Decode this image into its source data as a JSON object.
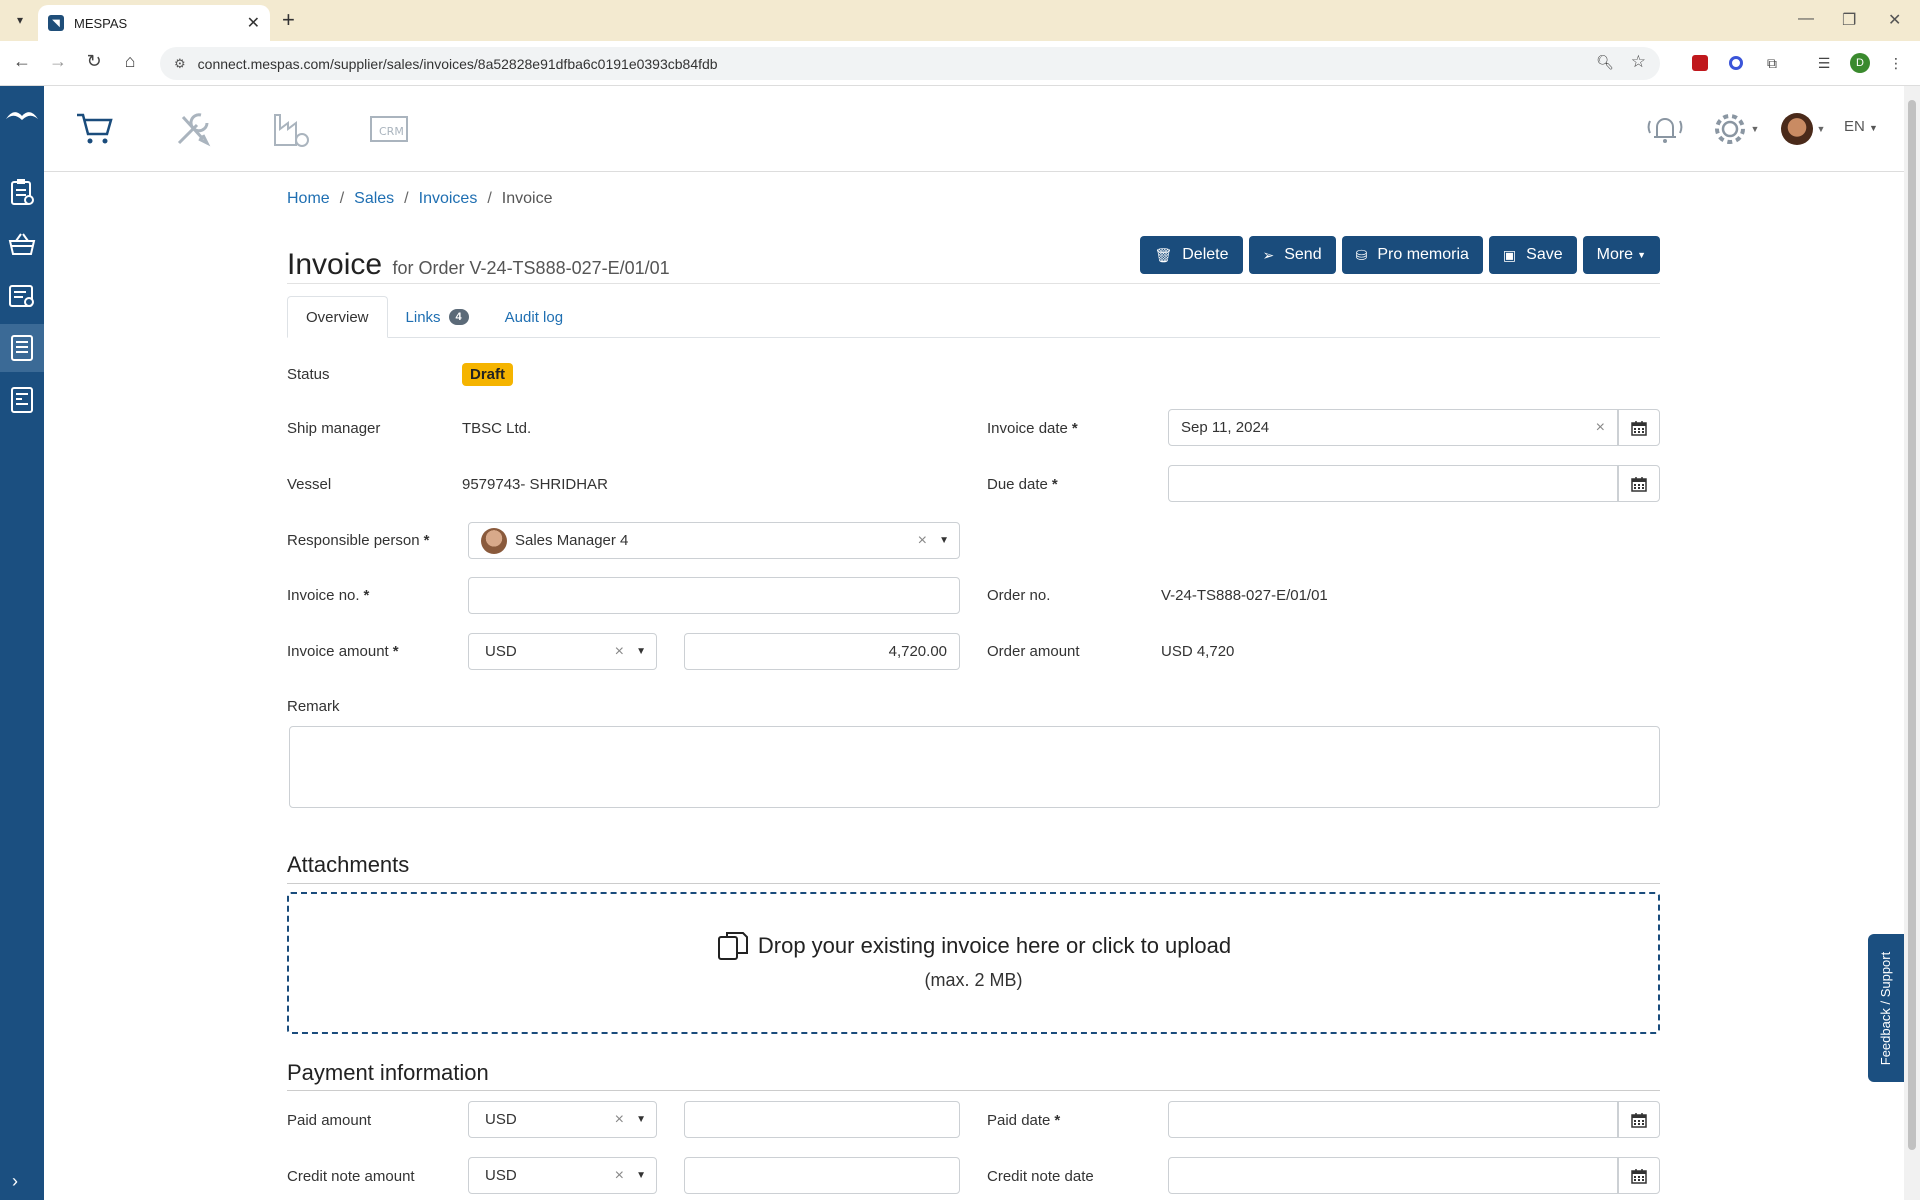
{
  "browser": {
    "tab_title": "MESPAS",
    "url": "connect.mespas.com/supplier/sales/invoices/8a52828e91dfba6c0191e0393cb84fdb",
    "profile_initial": "D"
  },
  "appbar": {
    "modules": [
      "cart-icon",
      "tools-icon",
      "factory-icon",
      "crm-icon"
    ],
    "crm_label": "CRM",
    "language": "EN"
  },
  "breadcrumb": {
    "home": "Home",
    "sales": "Sales",
    "invoices": "Invoices",
    "current": "Invoice",
    "sep": "/"
  },
  "page": {
    "title": "Invoice",
    "subtitle": "for Order V-24-TS888-027-E/01/01"
  },
  "actions": {
    "delete": "Delete",
    "send": "Send",
    "pro_memoria": "Pro memoria",
    "save": "Save",
    "more": "More"
  },
  "tabs": {
    "overview": "Overview",
    "links": "Links",
    "links_count": "4",
    "audit_log": "Audit log"
  },
  "form": {
    "status_label": "Status",
    "status_value": "Draft",
    "ship_manager_label": "Ship manager",
    "ship_manager_value": "TBSC Ltd.",
    "vessel_label": "Vessel",
    "vessel_value": "9579743- SHRIDHAR",
    "responsible_label": "Responsible person",
    "responsible_value": "Sales Manager 4",
    "invoice_no_label": "Invoice no.",
    "invoice_no_value": "",
    "invoice_amount_label": "Invoice amount",
    "invoice_currency": "USD",
    "invoice_amount_value": "4,720.00",
    "invoice_date_label": "Invoice date",
    "invoice_date_value": "Sep 11, 2024",
    "due_date_label": "Due date",
    "due_date_value": "",
    "order_no_label": "Order no.",
    "order_no_value": "V-24-TS888-027-E/01/01",
    "order_amount_label": "Order amount",
    "order_amount_value": "USD 4,720",
    "remark_label": "Remark",
    "required_mark": "*"
  },
  "attachments": {
    "title": "Attachments",
    "drop_text": "Drop your existing invoice here or click to upload",
    "max_size": "(max. 2 MB)"
  },
  "payment": {
    "title": "Payment information",
    "paid_amount_label": "Paid amount",
    "paid_currency": "USD",
    "paid_date_label": "Paid date",
    "credit_note_amount_label": "Credit note amount",
    "credit_currency": "USD",
    "credit_note_date_label": "Credit note date"
  },
  "feedback": "Feedback / Support",
  "colors": {
    "primary": "#1a4c7c",
    "sidebar": "#1b4f80",
    "link": "#1f6fb2",
    "draft_badge": "#f5b400"
  }
}
